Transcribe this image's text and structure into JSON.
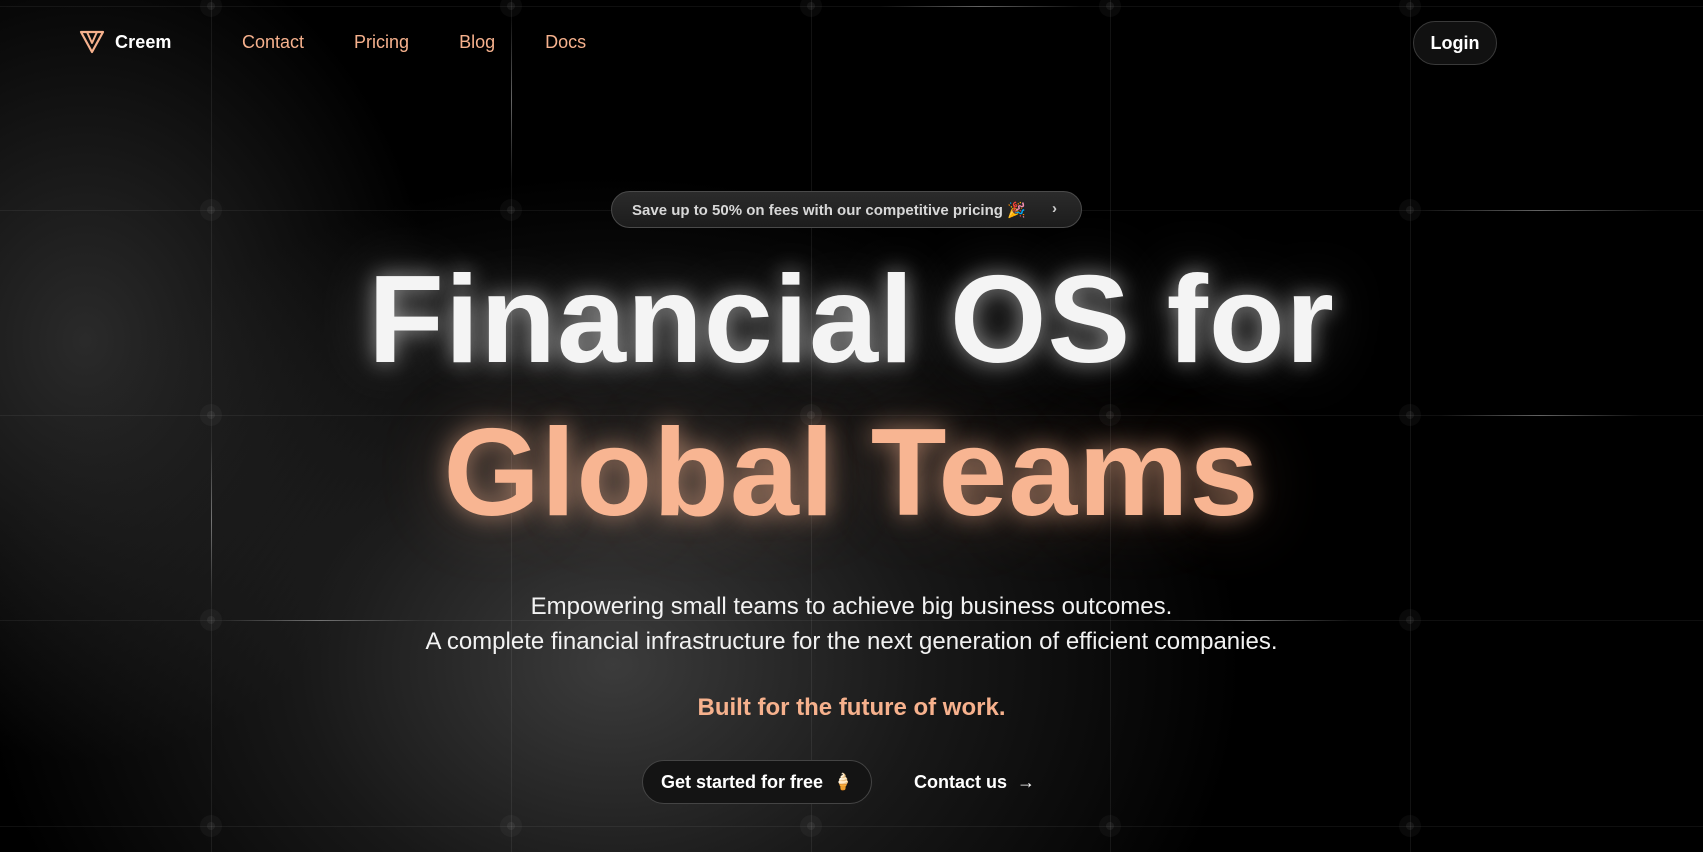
{
  "nav": {
    "brand": "Creem",
    "links": [
      "Contact",
      "Pricing",
      "Blog",
      "Docs"
    ],
    "login_label": "Login"
  },
  "promo": {
    "text": "Save up to 50% on fees with our competitive pricing 🎉",
    "chevron": "›"
  },
  "hero": {
    "headline_line1": "Financial OS for",
    "headline_line2": "Global Teams",
    "subtitle_line1": "Empowering small teams to achieve big business outcomes.",
    "subtitle_line2": "A complete financial infrastructure for the next generation of efficient companies.",
    "tagline": "Built for the future of work."
  },
  "cta": {
    "primary_label": "Get started for free",
    "primary_icon": "🍦",
    "secondary_label": "Contact us",
    "secondary_icon": "→"
  },
  "colors": {
    "accent": "#f6b18d",
    "background": "#000000",
    "text": "#ffffff"
  }
}
